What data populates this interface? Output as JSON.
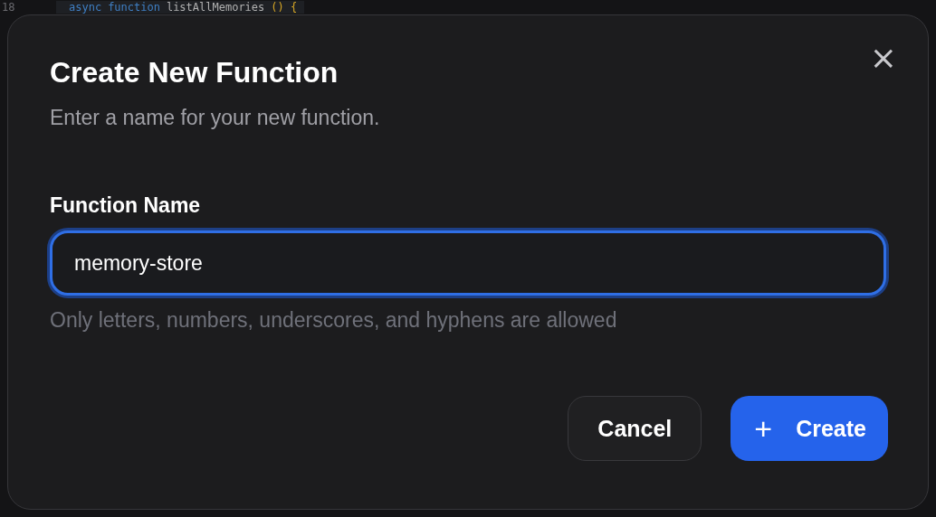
{
  "editor": {
    "line_number": "18",
    "code": [
      {
        "text": "async",
        "kind": "keyword"
      },
      {
        "text": "function",
        "kind": "keyword"
      },
      {
        "text": "listAllMemories",
        "kind": "name"
      },
      {
        "text": "() {",
        "kind": "bracket"
      }
    ]
  },
  "dialog": {
    "title": "Create New Function",
    "description": "Enter a name for your new function.",
    "close": "×",
    "field": {
      "label": "Function Name",
      "value": "memory-store",
      "focused": true,
      "hint": "Only letters, numbers, underscores, and hyphens are allowed"
    },
    "buttons": [
      {
        "label": "Cancel",
        "kind": "secondary"
      },
      {
        "label": "Create",
        "kind": "primary",
        "icon": "+"
      }
    ]
  }
}
